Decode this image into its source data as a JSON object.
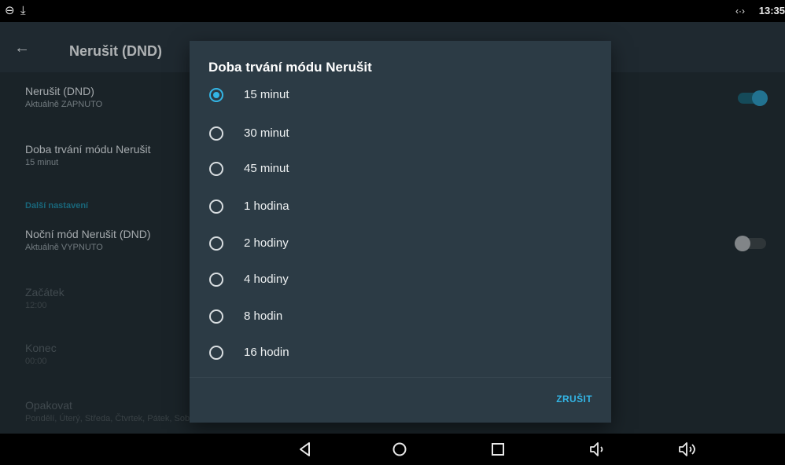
{
  "status_bar": {
    "time": "13:35",
    "left_icons": [
      "dnd-icon",
      "download-icon"
    ],
    "right_icons": [
      "data-sync-icon"
    ]
  },
  "app_bar": {
    "title": "Nerušit (DND)"
  },
  "settings": {
    "dnd": {
      "title": "Nerušit (DND)",
      "summary": "Aktuálně ZAPNUTO",
      "enabled": true
    },
    "duration": {
      "title": "Doba trvání módu Nerušit",
      "summary": "15 minut"
    },
    "category": "Další nastavení",
    "night_dnd": {
      "title": "Noční mód Nerušit (DND)",
      "summary": "Aktuálně VYPNUTO",
      "enabled": false
    },
    "start": {
      "title": "Začátek",
      "summary": "12:00"
    },
    "end": {
      "title": "Konec",
      "summary": "00:00"
    },
    "repeat": {
      "title": "Opakovat",
      "summary": "Pondělí, Úterý, Středa, Čtvrtek, Pátek, Sobota, Neděle"
    }
  },
  "dialog": {
    "title": "Doba trvání módu Nerušit",
    "selected_index": 0,
    "options": [
      "15 minut",
      "30 minut",
      "45 minut",
      "1 hodina",
      "2 hodiny",
      "4 hodiny",
      "8 hodin",
      "16 hodin"
    ],
    "cancel_label": "ZRUŠIT"
  },
  "nav_bar": {
    "buttons": [
      "back-icon",
      "home-icon",
      "recents-icon",
      "volume-down-icon",
      "volume-up-icon"
    ]
  },
  "colors": {
    "accent": "#33b5e5",
    "dialog_bg": "#2c3b45",
    "app_bg": "#202b31"
  }
}
